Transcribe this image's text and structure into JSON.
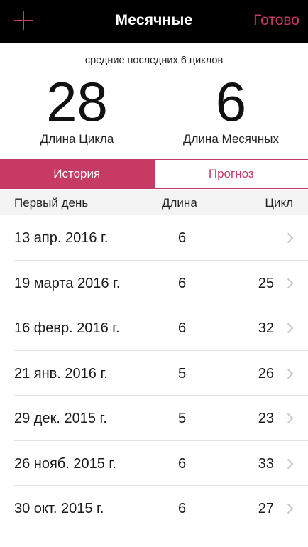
{
  "navbar": {
    "add_icon": "plus-icon",
    "title": "Месячные",
    "done_label": "Готово",
    "accent_color": "#c63a63"
  },
  "summary": {
    "caption": "средние последних 6 циклов",
    "cycle_length": {
      "value": "28",
      "label": "Длина Цикла"
    },
    "period_length": {
      "value": "6",
      "label": "Длина Месячных"
    }
  },
  "tabs": [
    {
      "label": "История",
      "active": true
    },
    {
      "label": "Прогноз",
      "active": false
    }
  ],
  "table": {
    "columns": {
      "first_day": "Первый день",
      "length": "Длина",
      "cycle": "Цикл"
    },
    "rows": [
      {
        "date": "13 апр. 2016 г.",
        "length": "6",
        "cycle": ""
      },
      {
        "date": "19 марта 2016 г.",
        "length": "6",
        "cycle": "25"
      },
      {
        "date": "16 февр. 2016 г.",
        "length": "6",
        "cycle": "32"
      },
      {
        "date": "21 янв. 2016 г.",
        "length": "5",
        "cycle": "26"
      },
      {
        "date": "29 дек. 2015 г.",
        "length": "5",
        "cycle": "23"
      },
      {
        "date": "26 нояб. 2015 г.",
        "length": "6",
        "cycle": "33"
      },
      {
        "date": "30 окт. 2015 г.",
        "length": "6",
        "cycle": "27"
      }
    ],
    "row_icon": "chevron-right-icon"
  }
}
